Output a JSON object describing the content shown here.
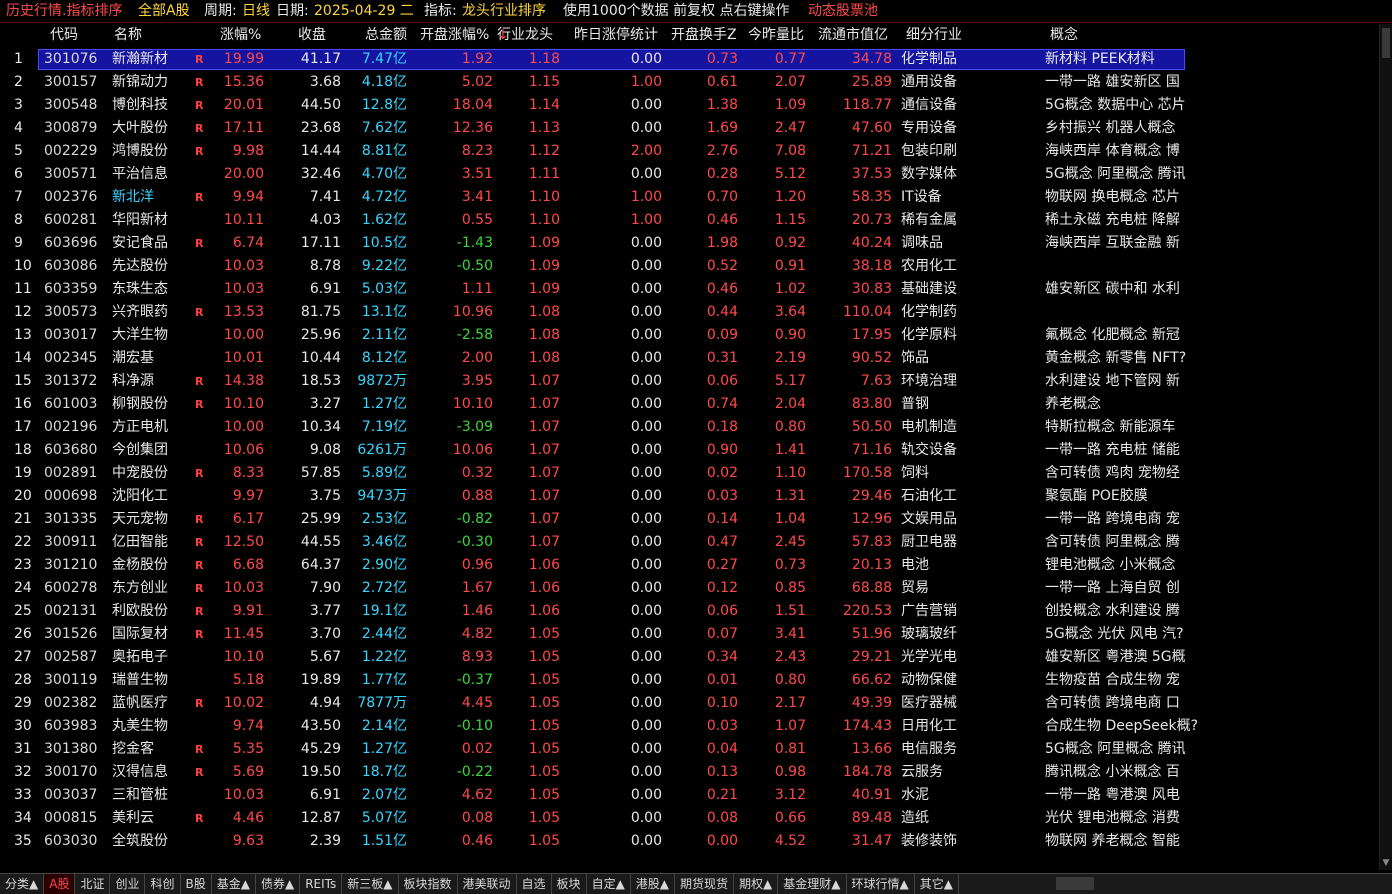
{
  "topbar": {
    "title": "历史行情.指标排序",
    "market": "全部A股",
    "period_label": "周期:",
    "period_value": "日线",
    "date_label": "日期:",
    "date_value": "2025-04-29 二",
    "indicator_label": "指标:",
    "indicator_value": "龙头行业排序",
    "info": "使用1000个数据 前复权 点右键操作",
    "pool": "动态股票池"
  },
  "columns": [
    "代码",
    "名称",
    "涨幅%",
    "收盘",
    "总金额",
    "开盘涨幅%",
    "行业龙头",
    "昨日涨停统计",
    "开盘换手Z",
    "今昨量比",
    "流通市值亿",
    "细分行业",
    "概念"
  ],
  "sort_arrow": "↓",
  "rows": [
    {
      "idx": "1",
      "code": "301076",
      "name": "新瀚新材",
      "r": "R",
      "pct": "19.99",
      "close": "41.17",
      "amt": "7.47亿",
      "open": "1.92",
      "lead": "1.18",
      "zt": "0.00",
      "turn": "0.73",
      "vol": "0.77",
      "mcap": "34.78",
      "ind": "化学制品",
      "concept": "新材料 PEEK材料"
    },
    {
      "idx": "2",
      "code": "300157",
      "name": "新锦动力",
      "r": "R",
      "pct": "15.36",
      "close": "3.68",
      "amt": "4.18亿",
      "open": "5.02",
      "lead": "1.15",
      "zt": "1.00",
      "turn": "0.61",
      "vol": "2.07",
      "mcap": "25.89",
      "ind": "通用设备",
      "concept": "一带一路 雄安新区 国"
    },
    {
      "idx": "3",
      "code": "300548",
      "name": "博创科技",
      "r": "R",
      "pct": "20.01",
      "close": "44.50",
      "amt": "12.8亿",
      "open": "18.04",
      "lead": "1.14",
      "zt": "0.00",
      "turn": "1.38",
      "vol": "1.09",
      "mcap": "118.77",
      "ind": "通信设备",
      "concept": "5G概念 数据中心 芯片"
    },
    {
      "idx": "4",
      "code": "300879",
      "name": "大叶股份",
      "r": "R",
      "pct": "17.11",
      "close": "23.68",
      "amt": "7.62亿",
      "open": "12.36",
      "lead": "1.13",
      "zt": "0.00",
      "turn": "1.69",
      "vol": "2.47",
      "mcap": "47.60",
      "ind": "专用设备",
      "concept": "乡村振兴 机器人概念"
    },
    {
      "idx": "5",
      "code": "002229",
      "name": "鸿博股份",
      "r": "R",
      "pct": "9.98",
      "close": "14.44",
      "amt": "8.81亿",
      "open": "8.23",
      "lead": "1.12",
      "zt": "2.00",
      "turn": "2.76",
      "vol": "7.08",
      "mcap": "71.21",
      "ind": "包装印刷",
      "concept": "海峡西岸 体育概念 博"
    },
    {
      "idx": "6",
      "code": "300571",
      "name": "平治信息",
      "r": "",
      "pct": "20.00",
      "close": "32.46",
      "amt": "4.70亿",
      "open": "3.51",
      "lead": "1.11",
      "zt": "0.00",
      "turn": "0.28",
      "vol": "5.12",
      "mcap": "37.53",
      "ind": "数字媒体",
      "concept": "5G概念 阿里概念 腾讯"
    },
    {
      "idx": "7",
      "code": "002376",
      "name": "新北洋",
      "r": "R",
      "pct": "9.94",
      "close": "7.41",
      "amt": "4.72亿",
      "open": "3.41",
      "lead": "1.10",
      "zt": "1.00",
      "turn": "0.70",
      "vol": "1.20",
      "mcap": "58.35",
      "ind": "IT设备",
      "concept": "物联网 换电概念 芯片",
      "cyan": true
    },
    {
      "idx": "8",
      "code": "600281",
      "name": "华阳新材",
      "r": "",
      "pct": "10.11",
      "close": "4.03",
      "amt": "1.62亿",
      "open": "0.55",
      "lead": "1.10",
      "zt": "1.00",
      "turn": "0.46",
      "vol": "1.15",
      "mcap": "20.73",
      "ind": "稀有金属",
      "concept": "稀土永磁 充电桩 降解"
    },
    {
      "idx": "9",
      "code": "603696",
      "name": "安记食品",
      "r": "R",
      "pct": "6.74",
      "close": "17.11",
      "amt": "10.5亿",
      "open": "-1.43",
      "lead": "1.09",
      "zt": "0.00",
      "turn": "1.98",
      "vol": "0.92",
      "mcap": "40.24",
      "ind": "调味品",
      "concept": "海峡西岸 互联金融 新"
    },
    {
      "idx": "10",
      "code": "603086",
      "name": "先达股份",
      "r": "",
      "pct": "10.03",
      "close": "8.78",
      "amt": "9.22亿",
      "open": "-0.50",
      "lead": "1.09",
      "zt": "0.00",
      "turn": "0.52",
      "vol": "0.91",
      "mcap": "38.18",
      "ind": "农用化工",
      "concept": ""
    },
    {
      "idx": "11",
      "code": "603359",
      "name": "东珠生态",
      "r": "",
      "pct": "10.03",
      "close": "6.91",
      "amt": "5.03亿",
      "open": "1.11",
      "lead": "1.09",
      "zt": "0.00",
      "turn": "0.46",
      "vol": "1.02",
      "mcap": "30.83",
      "ind": "基础建设",
      "concept": "雄安新区 碳中和 水利"
    },
    {
      "idx": "12",
      "code": "300573",
      "name": "兴齐眼药",
      "r": "R",
      "pct": "13.53",
      "close": "81.75",
      "amt": "13.1亿",
      "open": "10.96",
      "lead": "1.08",
      "zt": "0.00",
      "turn": "0.44",
      "vol": "3.64",
      "mcap": "110.04",
      "ind": "化学制药",
      "concept": ""
    },
    {
      "idx": "13",
      "code": "003017",
      "name": "大洋生物",
      "r": "",
      "pct": "10.00",
      "close": "25.96",
      "amt": "2.11亿",
      "open": "-2.58",
      "lead": "1.08",
      "zt": "0.00",
      "turn": "0.09",
      "vol": "0.90",
      "mcap": "17.95",
      "ind": "化学原料",
      "concept": "氟概念 化肥概念 新冠"
    },
    {
      "idx": "14",
      "code": "002345",
      "name": "潮宏基",
      "r": "",
      "pct": "10.01",
      "close": "10.44",
      "amt": "8.12亿",
      "open": "2.00",
      "lead": "1.08",
      "zt": "0.00",
      "turn": "0.31",
      "vol": "2.19",
      "mcap": "90.52",
      "ind": "饰品",
      "concept": "黄金概念 新零售 NFT?"
    },
    {
      "idx": "15",
      "code": "301372",
      "name": "科净源",
      "r": "R",
      "pct": "14.38",
      "close": "18.53",
      "amt": "9872万",
      "open": "3.95",
      "lead": "1.07",
      "zt": "0.00",
      "turn": "0.06",
      "vol": "5.17",
      "mcap": "7.63",
      "ind": "环境治理",
      "concept": "水利建设 地下管网 新"
    },
    {
      "idx": "16",
      "code": "601003",
      "name": "柳钢股份",
      "r": "R",
      "pct": "10.10",
      "close": "3.27",
      "amt": "1.27亿",
      "open": "10.10",
      "lead": "1.07",
      "zt": "0.00",
      "turn": "0.74",
      "vol": "2.04",
      "mcap": "83.80",
      "ind": "普钢",
      "concept": "养老概念"
    },
    {
      "idx": "17",
      "code": "002196",
      "name": "方正电机",
      "r": "",
      "pct": "10.00",
      "close": "10.34",
      "amt": "7.19亿",
      "open": "-3.09",
      "lead": "1.07",
      "zt": "0.00",
      "turn": "0.18",
      "vol": "0.80",
      "mcap": "50.50",
      "ind": "电机制造",
      "concept": "特斯拉概念 新能源车"
    },
    {
      "idx": "18",
      "code": "603680",
      "name": "今创集团",
      "r": "",
      "pct": "10.06",
      "close": "9.08",
      "amt": "6261万",
      "open": "10.06",
      "lead": "1.07",
      "zt": "0.00",
      "turn": "0.90",
      "vol": "1.41",
      "mcap": "71.16",
      "ind": "轨交设备",
      "concept": "一带一路 充电桩 储能"
    },
    {
      "idx": "19",
      "code": "002891",
      "name": "中宠股份",
      "r": "R",
      "pct": "8.33",
      "close": "57.85",
      "amt": "5.89亿",
      "open": "0.32",
      "lead": "1.07",
      "zt": "0.00",
      "turn": "0.02",
      "vol": "1.10",
      "mcap": "170.58",
      "ind": "饲料",
      "concept": "含可转债 鸡肉 宠物经"
    },
    {
      "idx": "20",
      "code": "000698",
      "name": "沈阳化工",
      "r": "",
      "pct": "9.97",
      "close": "3.75",
      "amt": "9473万",
      "open": "0.88",
      "lead": "1.07",
      "zt": "0.00",
      "turn": "0.03",
      "vol": "1.31",
      "mcap": "29.46",
      "ind": "石油化工",
      "concept": "聚氨酯 POE胶膜"
    },
    {
      "idx": "21",
      "code": "301335",
      "name": "天元宠物",
      "r": "R",
      "pct": "6.17",
      "close": "25.99",
      "amt": "2.53亿",
      "open": "-0.82",
      "lead": "1.07",
      "zt": "0.00",
      "turn": "0.14",
      "vol": "1.04",
      "mcap": "12.96",
      "ind": "文娱用品",
      "concept": "一带一路 跨境电商 宠"
    },
    {
      "idx": "22",
      "code": "300911",
      "name": "亿田智能",
      "r": "R",
      "pct": "12.50",
      "close": "44.55",
      "amt": "3.46亿",
      "open": "-0.30",
      "lead": "1.07",
      "zt": "0.00",
      "turn": "0.47",
      "vol": "2.45",
      "mcap": "57.83",
      "ind": "厨卫电器",
      "concept": "含可转债 阿里概念 腾"
    },
    {
      "idx": "23",
      "code": "301210",
      "name": "金杨股份",
      "r": "R",
      "pct": "6.68",
      "close": "64.37",
      "amt": "2.90亿",
      "open": "0.96",
      "lead": "1.06",
      "zt": "0.00",
      "turn": "0.27",
      "vol": "0.73",
      "mcap": "20.13",
      "ind": "电池",
      "concept": "锂电池概念 小米概念"
    },
    {
      "idx": "24",
      "code": "600278",
      "name": "东方创业",
      "r": "R",
      "pct": "10.03",
      "close": "7.90",
      "amt": "2.72亿",
      "open": "1.67",
      "lead": "1.06",
      "zt": "0.00",
      "turn": "0.12",
      "vol": "0.85",
      "mcap": "68.88",
      "ind": "贸易",
      "concept": "一带一路 上海自贸 创"
    },
    {
      "idx": "25",
      "code": "002131",
      "name": "利欧股份",
      "r": "R",
      "pct": "9.91",
      "close": "3.77",
      "amt": "19.1亿",
      "open": "1.46",
      "lead": "1.06",
      "zt": "0.00",
      "turn": "0.06",
      "vol": "1.51",
      "mcap": "220.53",
      "ind": "广告营销",
      "concept": "创投概念 水利建设 腾"
    },
    {
      "idx": "26",
      "code": "301526",
      "name": "国际复材",
      "r": "R",
      "pct": "11.45",
      "close": "3.70",
      "amt": "2.44亿",
      "open": "4.82",
      "lead": "1.05",
      "zt": "0.00",
      "turn": "0.07",
      "vol": "3.41",
      "mcap": "51.96",
      "ind": "玻璃玻纤",
      "concept": "5G概念 光伏 风电 汽?"
    },
    {
      "idx": "27",
      "code": "002587",
      "name": "奥拓电子",
      "r": "",
      "pct": "10.10",
      "close": "5.67",
      "amt": "1.22亿",
      "open": "8.93",
      "lead": "1.05",
      "zt": "0.00",
      "turn": "0.34",
      "vol": "2.43",
      "mcap": "29.21",
      "ind": "光学光电",
      "concept": "雄安新区 粤港澳 5G概"
    },
    {
      "idx": "28",
      "code": "300119",
      "name": "瑞普生物",
      "r": "",
      "pct": "5.18",
      "close": "19.89",
      "amt": "1.77亿",
      "open": "-0.37",
      "lead": "1.05",
      "zt": "0.00",
      "turn": "0.01",
      "vol": "0.80",
      "mcap": "66.62",
      "ind": "动物保健",
      "concept": "生物疫苗 合成生物 宠"
    },
    {
      "idx": "29",
      "code": "002382",
      "name": "蓝帆医疗",
      "r": "R",
      "pct": "10.02",
      "close": "4.94",
      "amt": "7877万",
      "open": "4.45",
      "lead": "1.05",
      "zt": "0.00",
      "turn": "0.10",
      "vol": "2.17",
      "mcap": "49.39",
      "ind": "医疗器械",
      "concept": "含可转债 跨境电商 口"
    },
    {
      "idx": "30",
      "code": "603983",
      "name": "丸美生物",
      "r": "",
      "pct": "9.74",
      "close": "43.50",
      "amt": "2.14亿",
      "open": "-0.10",
      "lead": "1.05",
      "zt": "0.00",
      "turn": "0.03",
      "vol": "1.07",
      "mcap": "174.43",
      "ind": "日用化工",
      "concept": "合成生物 DeepSeek概?"
    },
    {
      "idx": "31",
      "code": "301380",
      "name": "挖金客",
      "r": "R",
      "pct": "5.35",
      "close": "45.29",
      "amt": "1.27亿",
      "open": "0.02",
      "lead": "1.05",
      "zt": "0.00",
      "turn": "0.04",
      "vol": "0.81",
      "mcap": "13.66",
      "ind": "电信服务",
      "concept": "5G概念 阿里概念 腾讯"
    },
    {
      "idx": "32",
      "code": "300170",
      "name": "汉得信息",
      "r": "R",
      "pct": "5.69",
      "close": "19.50",
      "amt": "18.7亿",
      "open": "-0.22",
      "lead": "1.05",
      "zt": "0.00",
      "turn": "0.13",
      "vol": "0.98",
      "mcap": "184.78",
      "ind": "云服务",
      "concept": "腾讯概念 小米概念 百"
    },
    {
      "idx": "33",
      "code": "003037",
      "name": "三和管桩",
      "r": "",
      "pct": "10.03",
      "close": "6.91",
      "amt": "2.07亿",
      "open": "4.62",
      "lead": "1.05",
      "zt": "0.00",
      "turn": "0.21",
      "vol": "3.12",
      "mcap": "40.91",
      "ind": "水泥",
      "concept": "一带一路 粤港澳 风电"
    },
    {
      "idx": "34",
      "code": "000815",
      "name": "美利云",
      "r": "R",
      "pct": "4.46",
      "close": "12.87",
      "amt": "5.07亿",
      "open": "0.08",
      "lead": "1.05",
      "zt": "0.00",
      "turn": "0.08",
      "vol": "0.66",
      "mcap": "89.48",
      "ind": "造纸",
      "concept": "光伏 锂电池概念 消费"
    },
    {
      "idx": "35",
      "code": "603030",
      "name": "全筑股份",
      "r": "",
      "pct": "9.63",
      "close": "2.39",
      "amt": "1.51亿",
      "open": "0.46",
      "lead": "1.05",
      "zt": "0.00",
      "turn": "0.00",
      "vol": "4.52",
      "mcap": "31.47",
      "ind": "装修装饰",
      "concept": "物联网 养老概念 智能"
    }
  ],
  "tabs": [
    "分类▲",
    "A股",
    "北证",
    "创业",
    "科创",
    "B股",
    "基金▲",
    "债券▲",
    "REITs",
    "新三板▲",
    "板块指数",
    "港美联动",
    "自选",
    "板块",
    "自定▲",
    "港股▲",
    "期货现货",
    "期权▲",
    "基金理财▲",
    "环球行情▲",
    "其它▲"
  ],
  "active_tab": "A股",
  "colors": {
    "up": "#ff4a4a",
    "down": "#3cd63c",
    "amount": "#38d6ff",
    "selected_row": "#1414a0"
  }
}
